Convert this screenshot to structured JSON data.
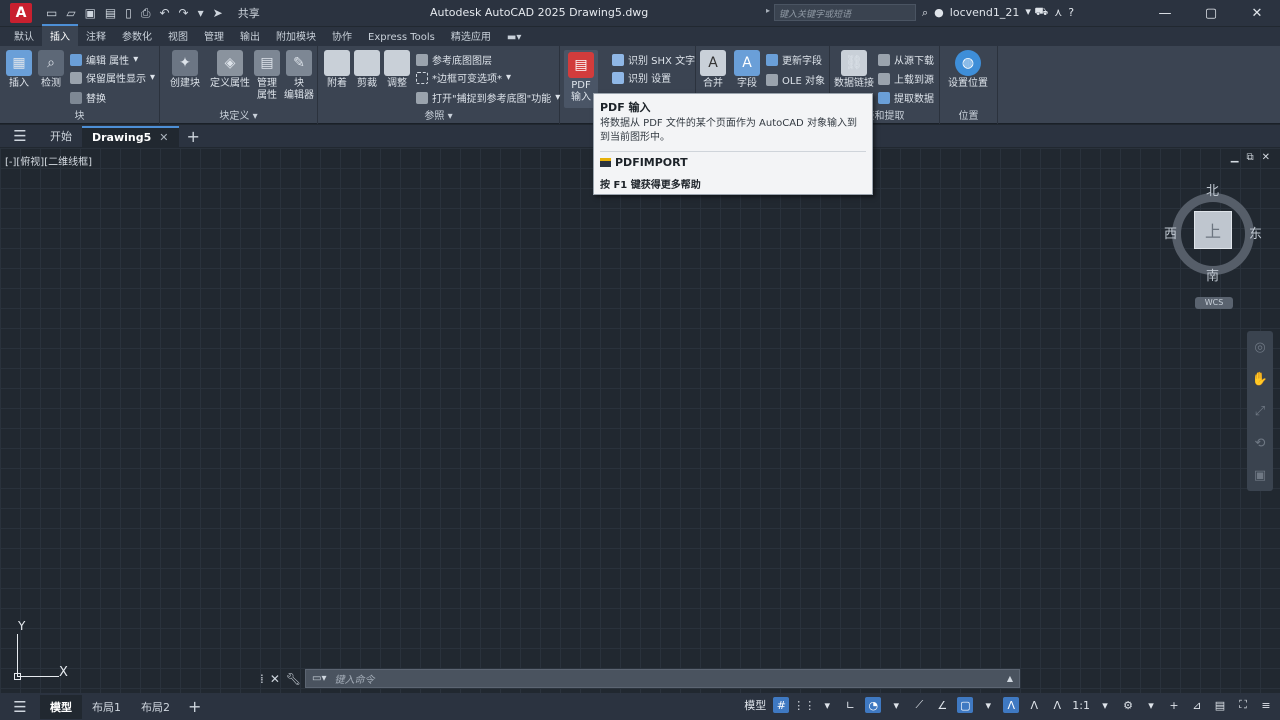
{
  "titlebar": {
    "app_logo": "A",
    "share": "共享",
    "title": "Autodesk AutoCAD 2025    Drawing5.dwg",
    "search_placeholder": "键入关键字或短语",
    "username": "locvend1_21"
  },
  "ribbon_tabs": [
    "默认",
    "插入",
    "注释",
    "参数化",
    "视图",
    "管理",
    "输出",
    "附加模块",
    "协作",
    "Express Tools",
    "精选应用"
  ],
  "ribbon": {
    "block": {
      "label": "块",
      "insert": "插入",
      "detect": "检测",
      "edit_attr": "编辑 属性",
      "keep_attr": "保留属性显示",
      "replace": "替换"
    },
    "block_def": {
      "label": "块定义",
      "create": "创建块",
      "define_attr": "定义属性",
      "manage_attr": "管理\n属性",
      "block_editor": "块\n编辑器"
    },
    "reference": {
      "label": "参照",
      "attach": "附着",
      "clip": "剪裁",
      "adjust": "调整",
      "underlay_layers": "参考底图图层",
      "frame": "*边框可变选项*",
      "snap": "打开\"捕捉到参考底图\"功能"
    },
    "import": {
      "pdf": "PDF\n输入",
      "shx_text": "识别 SHX 文字",
      "shx_settings": "识别 设置"
    },
    "data": {
      "merge": "合并",
      "field": "字段",
      "update_field": "更新字段",
      "ole": "OLE 对象"
    },
    "link": {
      "label": "接和提取",
      "data_link": "数据链接",
      "download": "从源下载",
      "upload": "上载到源",
      "extract": "提取数据"
    },
    "location": {
      "label": "位置",
      "set_location": "设置位置"
    }
  },
  "doc_tabs": {
    "start": "开始",
    "drawing": "Drawing5"
  },
  "canvas": {
    "view_label": "[-][俯视][二维线框]"
  },
  "viewcube": {
    "north": "北",
    "south": "南",
    "east": "东",
    "west": "西",
    "face": "上",
    "wcs": "WCS"
  },
  "ucs": {
    "x": "X",
    "y": "Y"
  },
  "cmdline": {
    "placeholder": "键入命令"
  },
  "status": {
    "model_tab": "模型",
    "layout1": "布局1",
    "layout2": "布局2",
    "model": "模型",
    "scale": "1:1"
  },
  "tooltip": {
    "title": "PDF 输入",
    "desc": "将数据从 PDF 文件的某个页面作为 AutoCAD 对象输入到到当前图形中。",
    "cmd": "PDFIMPORT",
    "help": "按 F1 键获得更多帮助"
  }
}
